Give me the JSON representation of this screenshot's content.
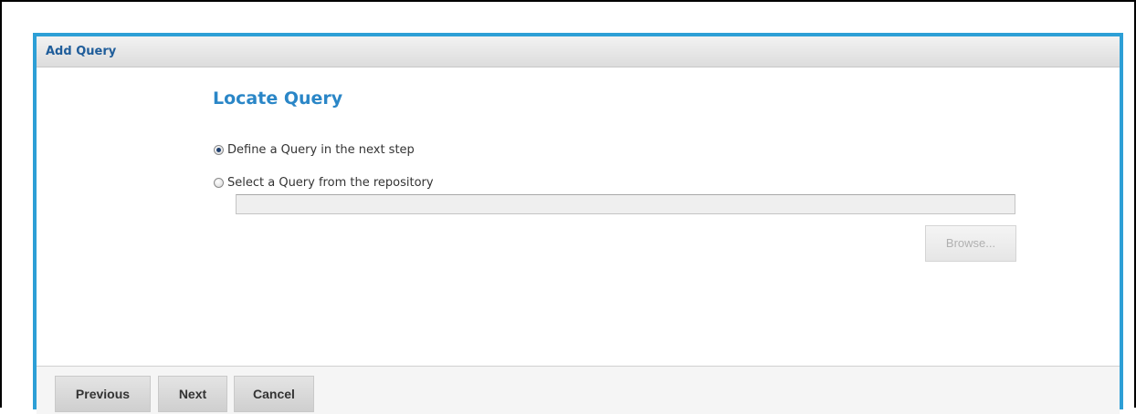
{
  "dialog": {
    "title": "Add Query"
  },
  "content": {
    "section_title": "Locate Query",
    "options": [
      {
        "label": "Define a Query in the next step",
        "selected": true
      },
      {
        "label": "Select a Query from the repository",
        "selected": false
      }
    ],
    "repository_path": {
      "value": "",
      "placeholder": ""
    },
    "browse_label": "Browse..."
  },
  "footer": {
    "previous_label": "Previous",
    "next_label": "Next",
    "cancel_label": "Cancel"
  },
  "colors": {
    "dialog_border": "#2d9fd6",
    "title_text": "#1f5d9a",
    "section_title": "#2a86c7"
  }
}
